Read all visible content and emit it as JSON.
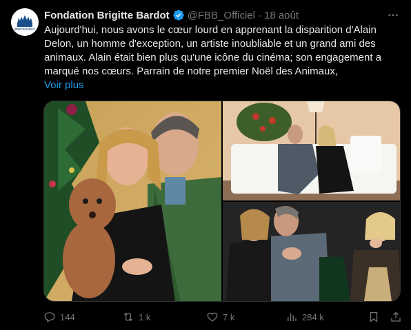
{
  "tweet": {
    "author_name": "Fondation Brigitte Bardot",
    "handle": "@FBB_Officiel",
    "separator": "·",
    "time": "18 août",
    "text": "Aujourd'hui, nous avons le cœur lourd en apprenant la disparition d'Alain Delon, un homme d'exception, un artiste inoubliable et un grand ami des animaux. Alain était bien plus qu'une icône du cinéma; son engagement a marqué nos cœurs. Parrain de notre premier Noël des Animaux,",
    "see_more": "Voir plus"
  },
  "avatar": {
    "logo_text": "BRIGITTE BARDOT"
  },
  "actions": {
    "replies": "144",
    "reposts": "1 k",
    "likes": "7 k",
    "views": "284 k"
  },
  "icons": {
    "verified": "verified-badge-icon",
    "more": "more-icon",
    "reply": "reply-icon",
    "repost": "repost-icon",
    "like": "heart-icon",
    "views": "views-icon",
    "bookmark": "bookmark-icon",
    "share": "share-icon"
  },
  "colors": {
    "background": "#000000",
    "text": "#e7e9ea",
    "muted": "#71767b",
    "link": "#1d9bf0",
    "verified": "#1d9bf0"
  }
}
